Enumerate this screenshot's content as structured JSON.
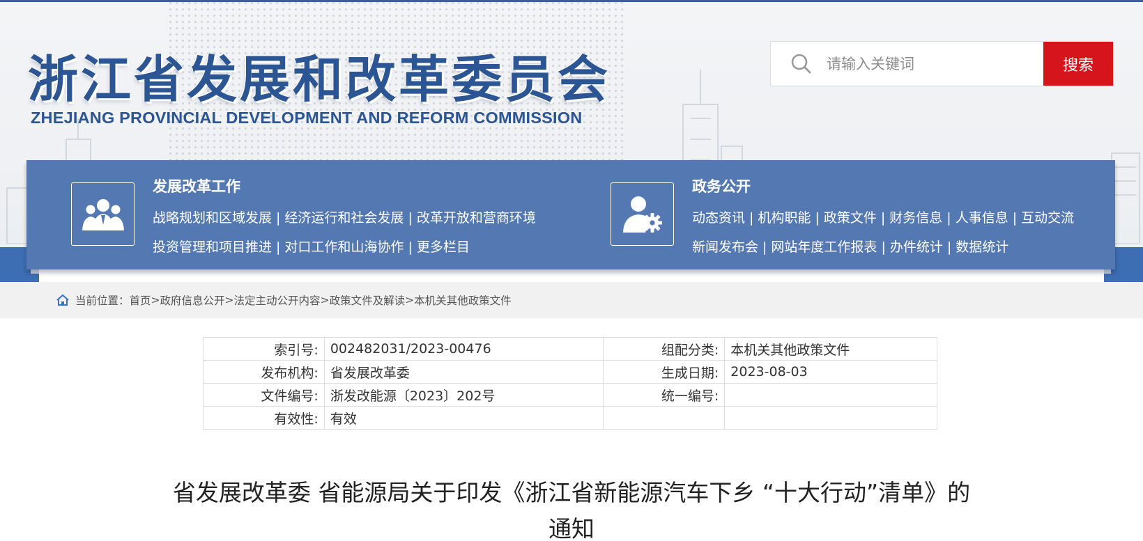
{
  "header": {
    "logo_cn": "浙江省发展和改革委员会",
    "logo_en": "ZHEJIANG PROVINCIAL DEVELOPMENT AND REFORM COMMISSION",
    "search": {
      "placeholder": "请输入关键词",
      "button_label": "搜索"
    }
  },
  "nav": {
    "left": {
      "title": "发展改革工作",
      "icon": "people-group-icon",
      "row1": [
        "战略规划和区域发展",
        "经济运行和社会发展",
        "改革开放和营商环境"
      ],
      "row2": [
        "投资管理和项目推进",
        "对口工作和山海协作",
        "更多栏目"
      ]
    },
    "right": {
      "title": "政务公开",
      "icon": "user-gear-icon",
      "row1": [
        "动态资讯",
        "机构职能",
        "政策文件",
        "财务信息",
        "人事信息",
        "互动交流"
      ],
      "row2": [
        "新闻发布会",
        "网站年度工作报表",
        "办件统计",
        "数据统计"
      ]
    }
  },
  "breadcrumb": {
    "prefix": "当前位置：",
    "items": [
      "首页",
      "政府信息公开",
      "法定主动公开内容",
      "政策文件及解读",
      "本机关其他政策文件"
    ],
    "separator": ">"
  },
  "info_table": {
    "rows": [
      {
        "label1": "索引号:",
        "value1": "002482031/2023-00476",
        "label2": "组配分类:",
        "value2": "本机关其他政策文件"
      },
      {
        "label1": "发布机构:",
        "value1": "省发展改革委",
        "label2": "生成日期:",
        "value2": "2023-08-03"
      },
      {
        "label1": "文件编号:",
        "value1": "浙发改能源〔2023〕202号",
        "label2": "统一编号:",
        "value2": ""
      },
      {
        "label1": "有效性:",
        "value1": "有效",
        "label2": "",
        "value2": ""
      }
    ]
  },
  "document": {
    "title_line1": "省发展改革委 省能源局关于印发《浙江省新能源汽车下乡 “十大行动”清单》的",
    "title_line2": "通知"
  },
  "colors": {
    "brand_blue": "#2c5594",
    "nav_blue": "#5478b2",
    "search_red": "#d6141c"
  }
}
